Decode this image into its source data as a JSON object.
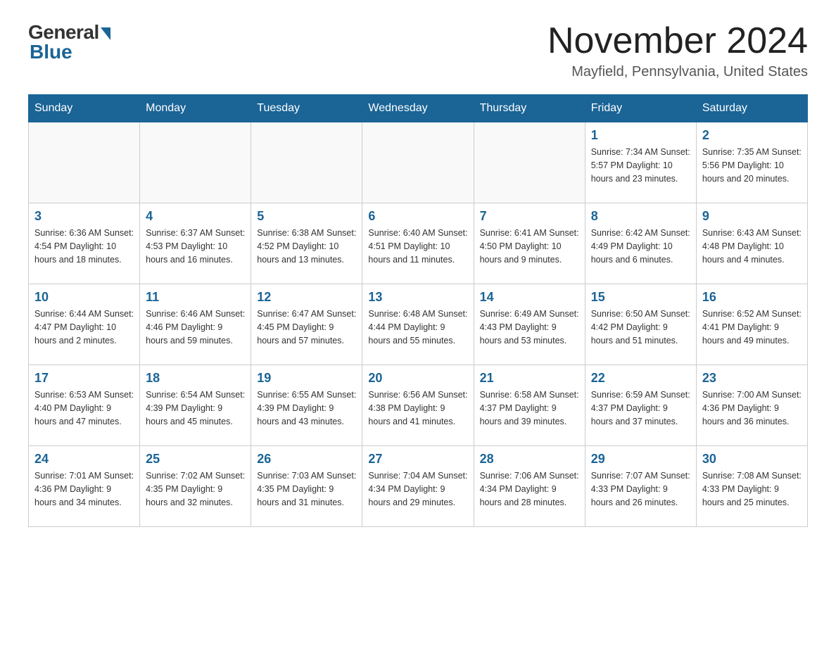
{
  "header": {
    "logo_general": "General",
    "logo_blue": "Blue",
    "month_title": "November 2024",
    "location": "Mayfield, Pennsylvania, United States"
  },
  "days_of_week": [
    "Sunday",
    "Monday",
    "Tuesday",
    "Wednesday",
    "Thursday",
    "Friday",
    "Saturday"
  ],
  "weeks": [
    [
      {
        "day": "",
        "info": ""
      },
      {
        "day": "",
        "info": ""
      },
      {
        "day": "",
        "info": ""
      },
      {
        "day": "",
        "info": ""
      },
      {
        "day": "",
        "info": ""
      },
      {
        "day": "1",
        "info": "Sunrise: 7:34 AM\nSunset: 5:57 PM\nDaylight: 10 hours and 23 minutes."
      },
      {
        "day": "2",
        "info": "Sunrise: 7:35 AM\nSunset: 5:56 PM\nDaylight: 10 hours and 20 minutes."
      }
    ],
    [
      {
        "day": "3",
        "info": "Sunrise: 6:36 AM\nSunset: 4:54 PM\nDaylight: 10 hours and 18 minutes."
      },
      {
        "day": "4",
        "info": "Sunrise: 6:37 AM\nSunset: 4:53 PM\nDaylight: 10 hours and 16 minutes."
      },
      {
        "day": "5",
        "info": "Sunrise: 6:38 AM\nSunset: 4:52 PM\nDaylight: 10 hours and 13 minutes."
      },
      {
        "day": "6",
        "info": "Sunrise: 6:40 AM\nSunset: 4:51 PM\nDaylight: 10 hours and 11 minutes."
      },
      {
        "day": "7",
        "info": "Sunrise: 6:41 AM\nSunset: 4:50 PM\nDaylight: 10 hours and 9 minutes."
      },
      {
        "day": "8",
        "info": "Sunrise: 6:42 AM\nSunset: 4:49 PM\nDaylight: 10 hours and 6 minutes."
      },
      {
        "day": "9",
        "info": "Sunrise: 6:43 AM\nSunset: 4:48 PM\nDaylight: 10 hours and 4 minutes."
      }
    ],
    [
      {
        "day": "10",
        "info": "Sunrise: 6:44 AM\nSunset: 4:47 PM\nDaylight: 10 hours and 2 minutes."
      },
      {
        "day": "11",
        "info": "Sunrise: 6:46 AM\nSunset: 4:46 PM\nDaylight: 9 hours and 59 minutes."
      },
      {
        "day": "12",
        "info": "Sunrise: 6:47 AM\nSunset: 4:45 PM\nDaylight: 9 hours and 57 minutes."
      },
      {
        "day": "13",
        "info": "Sunrise: 6:48 AM\nSunset: 4:44 PM\nDaylight: 9 hours and 55 minutes."
      },
      {
        "day": "14",
        "info": "Sunrise: 6:49 AM\nSunset: 4:43 PM\nDaylight: 9 hours and 53 minutes."
      },
      {
        "day": "15",
        "info": "Sunrise: 6:50 AM\nSunset: 4:42 PM\nDaylight: 9 hours and 51 minutes."
      },
      {
        "day": "16",
        "info": "Sunrise: 6:52 AM\nSunset: 4:41 PM\nDaylight: 9 hours and 49 minutes."
      }
    ],
    [
      {
        "day": "17",
        "info": "Sunrise: 6:53 AM\nSunset: 4:40 PM\nDaylight: 9 hours and 47 minutes."
      },
      {
        "day": "18",
        "info": "Sunrise: 6:54 AM\nSunset: 4:39 PM\nDaylight: 9 hours and 45 minutes."
      },
      {
        "day": "19",
        "info": "Sunrise: 6:55 AM\nSunset: 4:39 PM\nDaylight: 9 hours and 43 minutes."
      },
      {
        "day": "20",
        "info": "Sunrise: 6:56 AM\nSunset: 4:38 PM\nDaylight: 9 hours and 41 minutes."
      },
      {
        "day": "21",
        "info": "Sunrise: 6:58 AM\nSunset: 4:37 PM\nDaylight: 9 hours and 39 minutes."
      },
      {
        "day": "22",
        "info": "Sunrise: 6:59 AM\nSunset: 4:37 PM\nDaylight: 9 hours and 37 minutes."
      },
      {
        "day": "23",
        "info": "Sunrise: 7:00 AM\nSunset: 4:36 PM\nDaylight: 9 hours and 36 minutes."
      }
    ],
    [
      {
        "day": "24",
        "info": "Sunrise: 7:01 AM\nSunset: 4:36 PM\nDaylight: 9 hours and 34 minutes."
      },
      {
        "day": "25",
        "info": "Sunrise: 7:02 AM\nSunset: 4:35 PM\nDaylight: 9 hours and 32 minutes."
      },
      {
        "day": "26",
        "info": "Sunrise: 7:03 AM\nSunset: 4:35 PM\nDaylight: 9 hours and 31 minutes."
      },
      {
        "day": "27",
        "info": "Sunrise: 7:04 AM\nSunset: 4:34 PM\nDaylight: 9 hours and 29 minutes."
      },
      {
        "day": "28",
        "info": "Sunrise: 7:06 AM\nSunset: 4:34 PM\nDaylight: 9 hours and 28 minutes."
      },
      {
        "day": "29",
        "info": "Sunrise: 7:07 AM\nSunset: 4:33 PM\nDaylight: 9 hours and 26 minutes."
      },
      {
        "day": "30",
        "info": "Sunrise: 7:08 AM\nSunset: 4:33 PM\nDaylight: 9 hours and 25 minutes."
      }
    ]
  ]
}
